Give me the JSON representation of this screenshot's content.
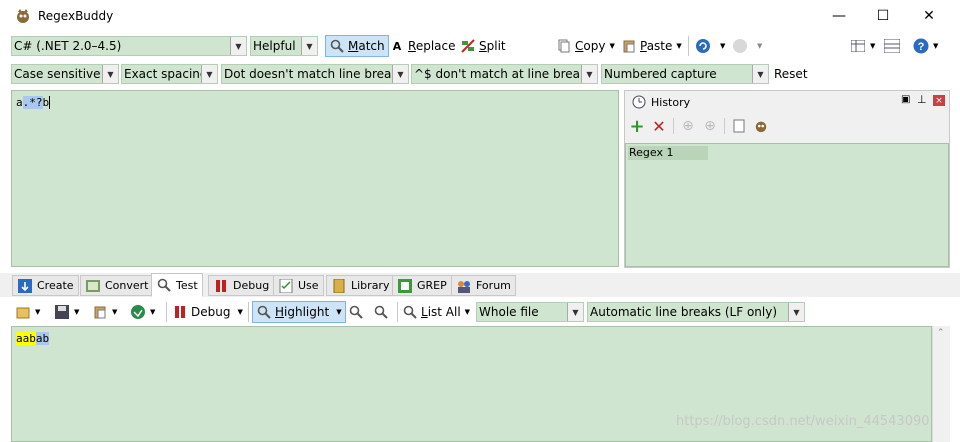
{
  "window": {
    "title": "RegexBuddy",
    "controls": {
      "minimize": "—",
      "maximize": "☐",
      "close": "✕"
    }
  },
  "toolbar1": {
    "flavor": "C# (.NET 2.0–4.5)",
    "helpful": "Helpful",
    "match": "Match",
    "replace": "Replace",
    "split": "Split",
    "copy": "Copy",
    "paste": "Paste"
  },
  "toolbar2": {
    "case": "Case sensitive",
    "spacing": "Exact spacing",
    "dot": "Dot doesn't match line breaks",
    "anchors": "^$ don't match at line breaks",
    "capture": "Numbered capture",
    "reset": "Reset"
  },
  "regex": {
    "prefix": "a",
    "highlighted": ".*?",
    "suffix": "b"
  },
  "history": {
    "title": "History",
    "items": [
      "Regex 1"
    ]
  },
  "tabs": [
    {
      "label": "Create"
    },
    {
      "label": "Convert"
    },
    {
      "label": "Test"
    },
    {
      "label": "Debug"
    },
    {
      "label": "Use"
    },
    {
      "label": "Library"
    },
    {
      "label": "GREP"
    },
    {
      "label": "Forum"
    }
  ],
  "test_toolbar": {
    "debug": "Debug",
    "highlight": "Highlight",
    "list_all": "List All",
    "scope": "Whole file",
    "line_breaks": "Automatic line breaks (LF only)"
  },
  "test_text": {
    "match1": "aab",
    "match2": "ab"
  },
  "watermark": "https://blog.csdn.net/weixin_44543090"
}
